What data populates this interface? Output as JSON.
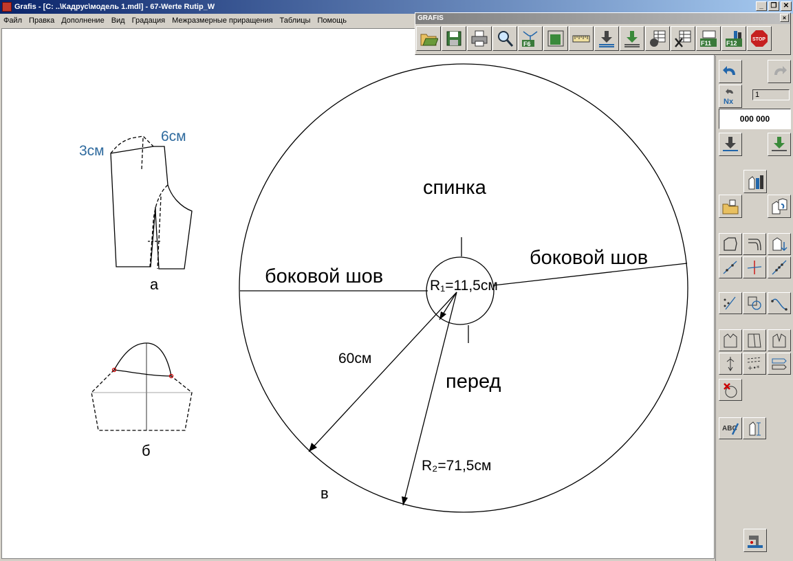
{
  "window": {
    "title": "Grafis - [C: ..\\Кадрус\\модель 1.mdl] - 67-Werte Rutip_W",
    "min_label": "_",
    "restore_label": "❐",
    "close_label": "✕"
  },
  "menu": {
    "items": [
      "Файл",
      "Правка",
      "Дополнение",
      "Вид",
      "Градация",
      "Межразмерные приращения",
      "Таблицы",
      "Помощь"
    ]
  },
  "toolbar": {
    "title": "GRAFIS",
    "close_label": "×",
    "buttons": [
      "open-icon",
      "save-icon",
      "print-icon",
      "zoom-icon",
      "f6-icon",
      "frame-icon",
      "ruler-icon",
      "download-icon",
      "download-green-icon",
      "g-table-icon",
      "x-table-icon",
      "f11-icon",
      "f12-icon",
      "stop-icon"
    ],
    "labels": {
      "f6": "F6",
      "f11": "F11",
      "f12": "F12",
      "stop": "STOP"
    }
  },
  "sidepanel": {
    "counter_value": "1",
    "display_value": "000 000",
    "nx_label": "Nx"
  },
  "drawing": {
    "label_3cm": "3см",
    "label_6cm": "6см",
    "caption_a": "а",
    "caption_b": "б",
    "caption_v": "в",
    "spinka": "спинка",
    "bokovoy_left": "боковой шов",
    "bokovoy_right": "боковой шов",
    "r1": "R₁=11,5см",
    "label_60": "60см",
    "pered": "перед",
    "r2": "R₂=71,5см"
  },
  "colors": {
    "accent_blue": "#2e6a9e",
    "title_bar_start": "#0a246a",
    "title_bar_end": "#a6caf0"
  }
}
